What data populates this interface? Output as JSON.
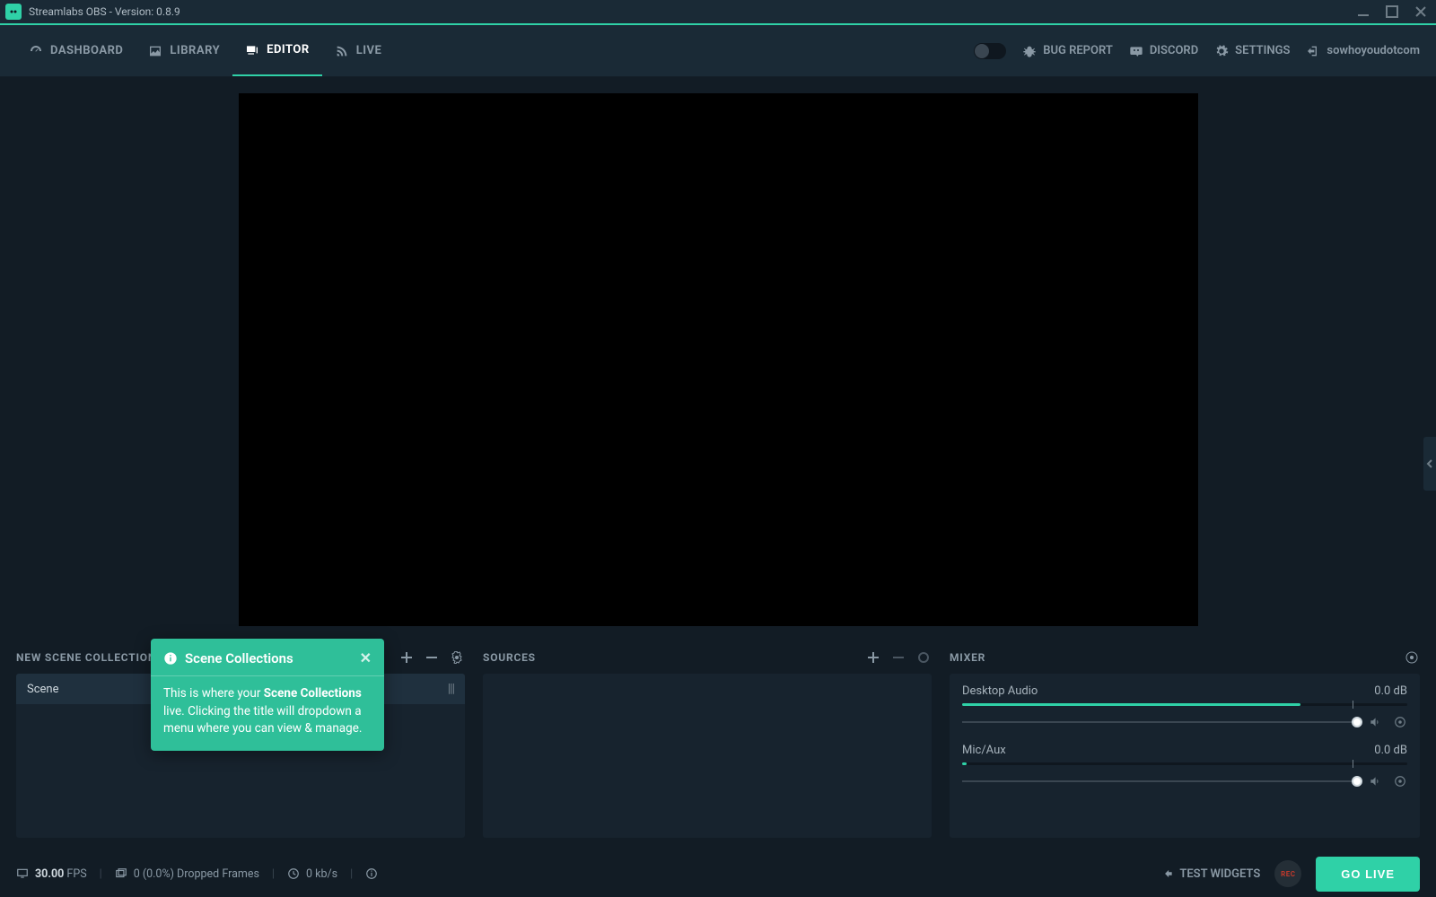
{
  "titlebar": {
    "title": "Streamlabs OBS - Version: 0.8.9"
  },
  "nav": {
    "dashboard": "DASHBOARD",
    "library": "LIBRARY",
    "editor": "EDITOR",
    "live": "LIVE"
  },
  "navRight": {
    "bugreport": "BUG REPORT",
    "discord": "DISCORD",
    "settings": "SETTINGS",
    "username": "sowhoyoudotcom"
  },
  "panels": {
    "scenesTitle": "NEW SCENE COLLECTION",
    "sourcesTitle": "SOURCES",
    "mixerTitle": "MIXER",
    "sceneName": "Scene"
  },
  "mixer": [
    {
      "name": "Desktop Audio",
      "db": "0.0 dB"
    },
    {
      "name": "Mic/Aux",
      "db": "0.0 dB"
    }
  ],
  "footer": {
    "fpsValue": "30.00",
    "fpsLabel": "FPS",
    "dropped": "0 (0.0%) Dropped Frames",
    "bitrate": "0 kb/s",
    "testWidgets": "TEST WIDGETS",
    "rec": "REC",
    "golive": "GO LIVE"
  },
  "tooltip": {
    "title": "Scene Collections",
    "body_pre": "This is where your ",
    "body_bold": "Scene Collections",
    "body_post": " live. Clicking the title will dropdown a menu where you can view & manage."
  }
}
